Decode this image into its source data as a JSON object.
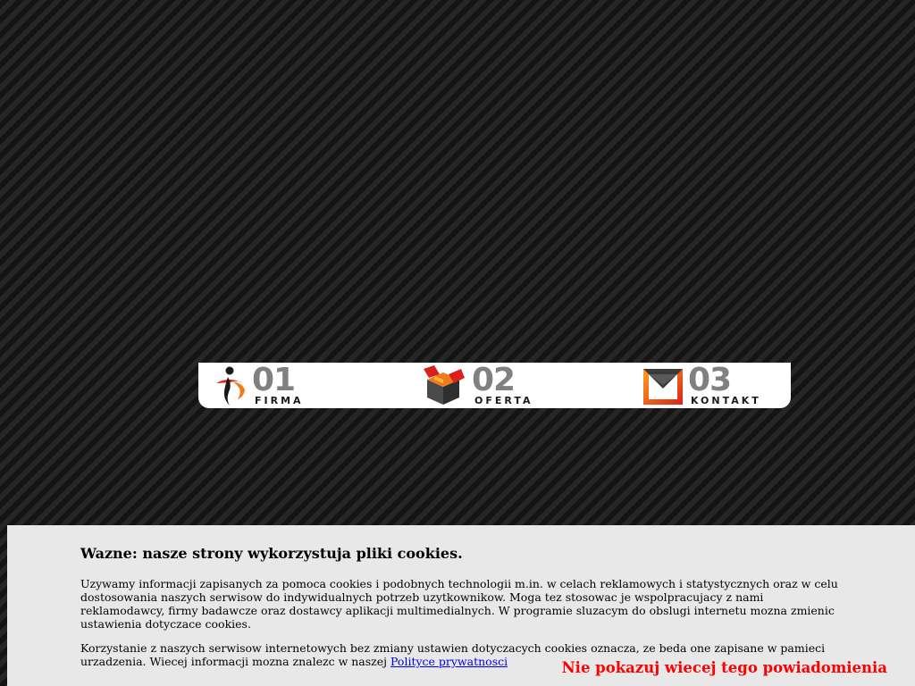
{
  "navigation": {
    "items": [
      {
        "number": "01",
        "label": "FIRMA",
        "icon": "person-icon"
      },
      {
        "number": "02",
        "label": "OFERTA",
        "icon": "open-box-icon"
      },
      {
        "number": "03",
        "label": "KONTAKT",
        "icon": "envelope-icon"
      }
    ]
  },
  "cookie_banner": {
    "title": "Wazne: nasze strony wykorzystuja pliki cookies.",
    "paragraph1": "Uzywamy informacji zapisanych za pomoca cookies i podobnych technologii m.in. w celach reklamowych i statystycznych oraz w celu dostosowania naszych serwisow do indywidualnych potrzeb uzytkownikow. Moga tez stosowac je wspolpracujacy z nami reklamodawcy, firmy badawcze oraz dostawcy aplikacji multimedialnych. W programie sluzacym do obslugi internetu mozna zmienic ustawienia dotyczace cookies.",
    "paragraph2_text": "Korzystanie z naszych serwisow internetowych bez zmiany ustawien dotyczacych cookies oznacza, ze beda one zapisane w pamieci urzadzenia. Wiecej informacji mozna znalezc w naszej ",
    "privacy_link": "Polityce prywatnosci",
    "dismiss_label": "Nie pokazuj wiecej tego powiadomienia"
  },
  "colors": {
    "background": "#1b1b1b",
    "nav_number": "#808080",
    "dismiss": "#ff0000",
    "link": "#0000ee",
    "banner": "#e8e8e8",
    "accent_orange": "#f07b1a",
    "accent_red": "#d9231a"
  }
}
